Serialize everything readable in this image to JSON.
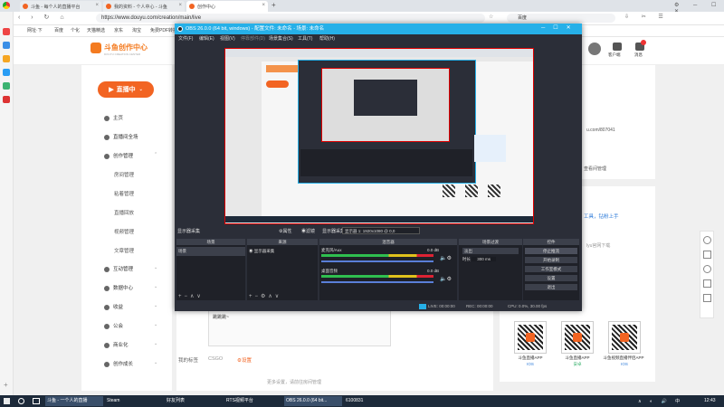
{
  "browser": {
    "tabs": [
      {
        "title": "斗鱼 - 每个人的直播平台"
      },
      {
        "title": "我的资料 - 个人中心 - 斗鱼"
      },
      {
        "title": "创作中心"
      }
    ],
    "url": "https://www.douyu.com/creation/main/live",
    "bookmarks": [
      "网址·下",
      "百度",
      "个化",
      "天猫精选",
      "京东",
      "淘宝",
      "免费PDF转换"
    ],
    "profile_name": "百度"
  },
  "site": {
    "logo": "斗鱼创作中心",
    "logo_sub": "DOUYU CREATION CENTER",
    "header_icons": [
      "客户端",
      "消息"
    ],
    "live_button": "直播中",
    "nav": [
      {
        "label": "主页",
        "type": "main"
      },
      {
        "label": "直播间全场",
        "type": "main"
      },
      {
        "label": "创作管理",
        "type": "main",
        "expandable": true
      },
      {
        "label": "房间管理",
        "type": "sub"
      },
      {
        "label": "粘着管理",
        "type": "sub"
      },
      {
        "label": "直播回放",
        "type": "sub"
      },
      {
        "label": "视频管理",
        "type": "sub"
      },
      {
        "label": "文章管理",
        "type": "sub"
      },
      {
        "label": "互动管理",
        "type": "main",
        "expandable": true
      },
      {
        "label": "数据中心",
        "type": "main",
        "expandable": true
      },
      {
        "label": "收益",
        "type": "main",
        "expandable": true
      },
      {
        "label": "公会",
        "type": "main",
        "expandable": true
      },
      {
        "label": "商业化",
        "type": "main",
        "expandable": true
      },
      {
        "label": "创作成长",
        "type": "main",
        "expandable": true
      }
    ],
    "main": {
      "textbox_text": "跳跳跳~",
      "tags_label": "我的标签",
      "tag_value": "CSGO",
      "tag_setting": "设置",
      "footer_link": "更多设置，请前往房间管理"
    },
    "right": {
      "url_fragment": "u.com/807041",
      "link": "查看间管理",
      "promo_1": "工具，钻粉上手",
      "promo_2": "lyu官网下载",
      "qr_items": [
        {
          "title": "斗鱼直播APP",
          "os": "IOS"
        },
        {
          "title": "斗鱼直播APP",
          "os": "安卓"
        },
        {
          "title": "斗鱼视频直播伴侣APP",
          "os": "IOS"
        }
      ]
    }
  },
  "obs": {
    "title": "OBS 26.0.0 (64 bit, windows) - 配置文件: 未命名 - 场景: 未命名",
    "menu": [
      "文件(F)",
      "编辑(E)",
      "视图(V)",
      "停靠部件(D)",
      "场景集合(S)",
      "工具(T)",
      "帮助(H)"
    ],
    "source_bar": {
      "label": "显示器采集",
      "props": "属性",
      "filter": "滤镜",
      "display": "显示器 1: 1920x1080 @ 0,0"
    },
    "docks": {
      "scenes": "场景",
      "sources": "来源",
      "mixer": "混音器",
      "transitions": "场景过渡",
      "controls": "控件"
    },
    "scene_item": "场景",
    "source_item": "显示器采集",
    "mixer_tracks": [
      {
        "name": "麦克风/Aux",
        "db": "0.0 dB"
      },
      {
        "name": "桌面音频",
        "db": "0.0 dB"
      }
    ],
    "transition": {
      "type": "淡出",
      "duration_label": "时长",
      "duration": "300 ms"
    },
    "controls": [
      "停止推流",
      "开始录制",
      "工作室模式",
      "设置",
      "退出"
    ],
    "status": {
      "live": "LIVE: 00:00:00",
      "rec": "REC: 00:00:00",
      "cpu": "CPU: 0.0%, 30.00 fps"
    }
  },
  "taskbar": {
    "items": [
      "斗鱼 - 一个人的直播",
      "Steam",
      "好友列表",
      "RTS视频平台",
      "OBS 26.0.0 (64 bit...",
      "6100831"
    ],
    "time": "12:43"
  }
}
